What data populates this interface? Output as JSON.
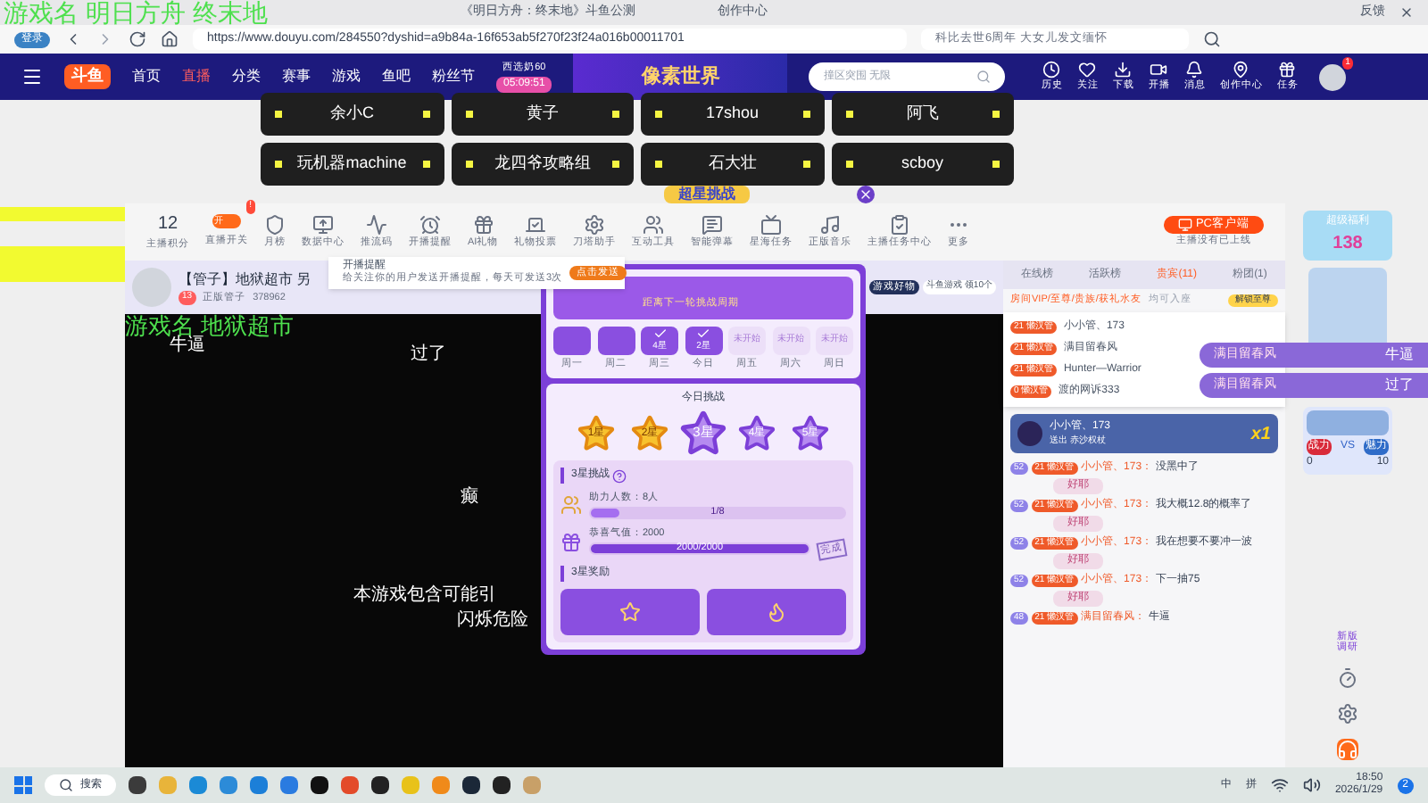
{
  "browser": {
    "overlay_caption": "游戏名 明日方舟 终末地",
    "login": "登录",
    "tabs": [
      "《明日方舟：终末地》斗鱼公测",
      "创作中心"
    ],
    "feedback": "反馈",
    "url": "https://www.douyu.com/284550?dyshid=a9b84a-16f653ab5f270f23f24a016b00011701",
    "search_placeholder": "科比去世6周年 大女儿发文缅怀"
  },
  "nav": {
    "logo": "斗鱼",
    "items": [
      {
        "label": "首页",
        "selected": false
      },
      {
        "label": "直播",
        "selected": true
      },
      {
        "label": "分类",
        "selected": false
      },
      {
        "label": "赛事",
        "selected": false
      },
      {
        "label": "游戏",
        "selected": false
      },
      {
        "label": "鱼吧",
        "selected": false
      },
      {
        "label": "粉丝节",
        "selected": false
      }
    ],
    "promo": {
      "title": "西选奶60",
      "timer": "05:09:51"
    },
    "banner": "像素世界",
    "search_placeholder": "撞区突围 无限",
    "actions": [
      "历史",
      "关注",
      "下载",
      "开播",
      "消息",
      "创作中心",
      "任务"
    ],
    "avatar_badge": "1"
  },
  "streamers": [
    "余小C",
    "黄子",
    "17shou",
    "阿飞",
    "玩机器machine",
    "龙四爷攻略组",
    "石大壮",
    "scboy"
  ],
  "event_title": "超星挑战",
  "toolbar": {
    "score": {
      "value": "12",
      "label": "主播积分"
    },
    "switch": {
      "label": "直播开关",
      "text": "开",
      "on": true,
      "badge": "!"
    },
    "items": [
      "月榜",
      "数据中心",
      "推流码",
      "开播提醒",
      "AI礼物",
      "礼物投票",
      "刀塔助手",
      "互动工具",
      "智能弹幕",
      "星海任务",
      "正版音乐",
      "主播任务中心",
      "更多"
    ],
    "pc_client": "PC客户端",
    "pc_status": "主播没有已上线"
  },
  "room": {
    "title": "【管子】地狱超市 另",
    "level": "13",
    "owner": "正版管子",
    "heat": "378962"
  },
  "reminder": {
    "title": "开播提醒",
    "text": "给关注你的用户发送开播提醒，每天可发送3次",
    "button": "点击发送"
  },
  "video": {
    "overlay_caption": "游戏名 地狱超市",
    "subtitles": [
      "牛逼",
      "过了",
      "癫",
      "本游戏包含可能引",
      "闪烁危险"
    ]
  },
  "challenge": {
    "header": "距离下一轮挑战周期",
    "days": [
      {
        "label": "周一",
        "done": true
      },
      {
        "label": "周二",
        "done": true
      },
      {
        "label": "周三",
        "result": "4星",
        "done": true
      },
      {
        "label": "今日",
        "result": "2星",
        "done": true
      },
      {
        "label": "周五",
        "result": "未开始",
        "done": false
      },
      {
        "label": "周六",
        "result": "未开始",
        "done": false
      },
      {
        "label": "周日",
        "result": "未开始",
        "done": false
      }
    ],
    "today_title": "今日挑战",
    "stars": [
      {
        "label": "1星",
        "selected": false,
        "done": true
      },
      {
        "label": "2星",
        "selected": false,
        "done": true
      },
      {
        "label": "3星",
        "selected": true,
        "done": false
      },
      {
        "label": "4星",
        "selected": false,
        "done": false
      },
      {
        "label": "5星",
        "selected": false,
        "done": false
      }
    ],
    "task_title": "3星挑战",
    "tasks": [
      {
        "label": "助力人数：8人",
        "reading": "1/8",
        "level": 0.125,
        "completed": false
      },
      {
        "label": "恭喜气值：2000",
        "reading": "2000/2000",
        "level": 1,
        "completed": true,
        "stamp": "完成"
      }
    ],
    "reward_title": "3星奖励"
  },
  "room_ad": {
    "title": "游戏好物",
    "button": "斗鱼游戏 领10个"
  },
  "chat": {
    "tabs": [
      {
        "label": "在线榜",
        "selected": false
      },
      {
        "label": "活跃榜",
        "selected": false
      },
      {
        "label": "贵宾(11)",
        "selected": true
      },
      {
        "label": "粉团(1)",
        "selected": false
      }
    ],
    "vip_notice": "房间VIP/至尊/贵族/获礼水友",
    "vip_suffix": "均可入座",
    "vip_button": "解锁至尊",
    "seats": [
      {
        "badge": "懒汉管",
        "level": "21",
        "name": "小小管、173"
      },
      {
        "badge": "懒汉管",
        "level": "21",
        "name": "满目留春风"
      },
      {
        "badge": "懒汉管",
        "level": "21",
        "name": "Hunter—Warrior"
      },
      {
        "badge": "懒汉管",
        "level": "0",
        "name": "渡的网诉333"
      }
    ],
    "gift": {
      "name": "小小管、173",
      "text": "送出 赤沙权杖",
      "count": "x1"
    },
    "messages": [
      {
        "level": "52",
        "badge": "懒汉管",
        "fan": "21",
        "name": "小小管、173：",
        "text": "没黑中了",
        "sticker": "好耶"
      },
      {
        "level": "52",
        "badge": "懒汉管",
        "fan": "21",
        "name": "小小管、173：",
        "text": "我大概12.8的概率了",
        "sticker": "好耶"
      },
      {
        "level": "52",
        "badge": "懒汉管",
        "fan": "21",
        "name": "小小管、173：",
        "text": "我在想要不要冲一波",
        "sticker": "好耶"
      },
      {
        "level": "52",
        "badge": "懒汉管",
        "fan": "21",
        "name": "小小管、173：",
        "text": "下一抽75",
        "sticker": "好耶"
      },
      {
        "level": "48",
        "badge": "懒汉管",
        "fan": "21",
        "name": "满目留春风：",
        "text": "牛逼"
      }
    ]
  },
  "danmaku": [
    {
      "name": "满目留春风",
      "text": "牛逼"
    },
    {
      "name": "满目留春风",
      "text": "过了"
    }
  ],
  "rail": {
    "promo": "超级福利",
    "promo_number": "138",
    "pk": {
      "left": "战力",
      "vs": "VS",
      "right": "魅力",
      "left_score": "0",
      "right_score": "10"
    },
    "survey": "新版调研"
  },
  "taskbar": {
    "search": "搜索",
    "ime": "中",
    "ime2": "拼",
    "time": "18:50",
    "date": "2026/1/29",
    "notifications": "2"
  }
}
